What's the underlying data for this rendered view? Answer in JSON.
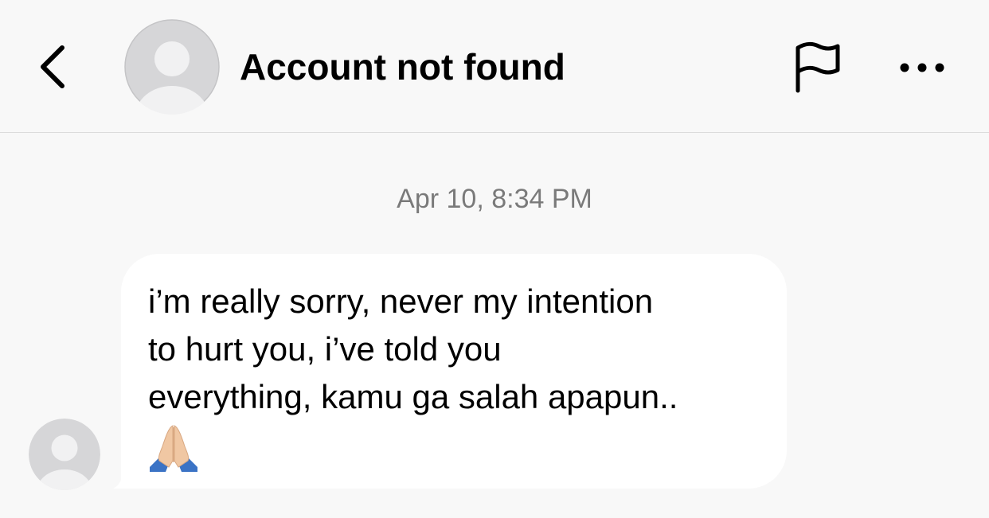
{
  "header": {
    "back_icon": "chevron-left-icon",
    "title": "Account not found",
    "flag_icon": "flag-icon",
    "more_icon": "more-horizontal-icon"
  },
  "conversation": {
    "timestamp": "Apr 10, 8:34 PM",
    "messages": [
      {
        "text": "i’m really sorry, never my intention\nto hurt you, i’ve told you\neverything, kamu ga salah apapun..",
        "emoji": "🙏🏼",
        "emoji_icon": "folded-hands-icon"
      }
    ]
  },
  "colors": {
    "background": "#f8f8f8",
    "bubble": "#ffffff",
    "timestamp": "#7a7a7a",
    "divider": "#dcdcdc",
    "avatar_bg": "#d6d6d8",
    "avatar_fg": "#f1f1f2"
  }
}
